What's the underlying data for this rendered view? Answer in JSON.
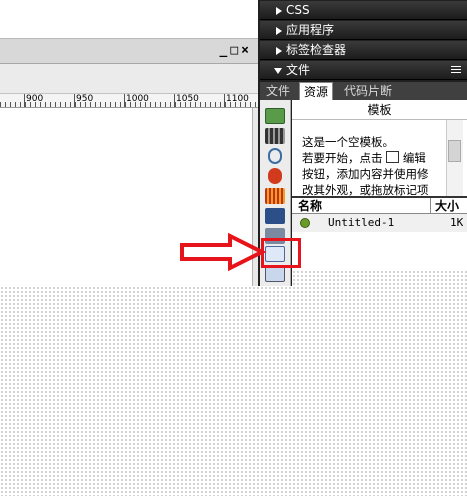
{
  "panels": {
    "css": "CSS",
    "app": "应用程序",
    "tag_inspector": "标签检查器",
    "files": "文件"
  },
  "tabs": [
    "文件",
    "资源",
    "代码片断"
  ],
  "assets": {
    "category_title": "模板",
    "description_lines": [
      "这是一个空模板。",
      "若要开始，点击",
      "编辑",
      "按钮，添加内容并使用修",
      "改其外观，或拖放标记项"
    ],
    "col_name": "名称",
    "col_size": "大小",
    "rows": [
      {
        "name": "Untitled-1",
        "size": "1K"
      }
    ]
  },
  "ruler": [
    "900",
    "950",
    "1000",
    "1050",
    "1100"
  ],
  "window_buttons": [
    "_",
    "□",
    "×"
  ],
  "colors": {
    "highlight": "#e8141c",
    "panel_bg": "#202020"
  },
  "icons": [
    "images-icon",
    "colors-icon",
    "urls-icon",
    "flash-icon",
    "shockwave-icon",
    "movies-icon",
    "scripts-icon",
    "templates-icon",
    "library-icon"
  ]
}
